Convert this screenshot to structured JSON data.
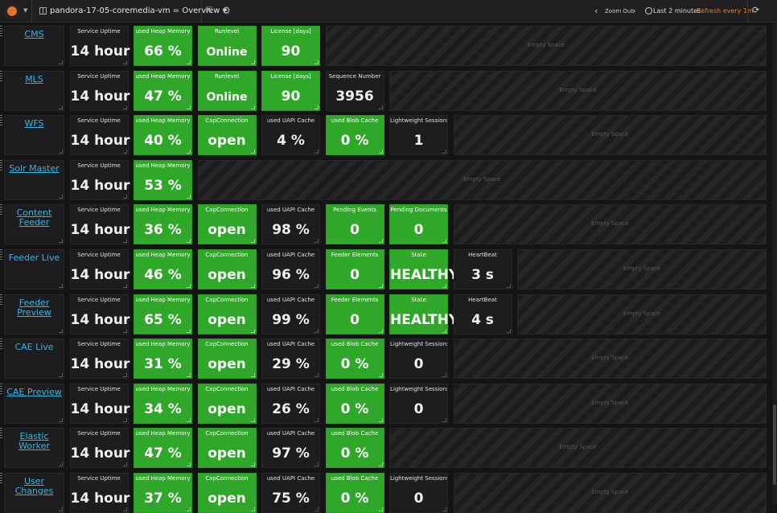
{
  "header": {
    "dashboard_title": "pandora-17-05-coremedia-vm = Overview",
    "zoom_out": "Zoom Out",
    "time_range": "Last 2 minutes",
    "refresh": "Refresh every 1m",
    "empty_space_label": "Empty Space"
  },
  "colors": {
    "green": "#2fa82a",
    "link": "#33b5e5",
    "refresh": "#eb7b18",
    "background": "#141414"
  },
  "rows": [
    {
      "name": "CMS",
      "link": true,
      "panels": [
        {
          "title": "Service Uptime",
          "value": "14 hour",
          "green": false
        },
        {
          "title": "used Heap Memory",
          "value": "66 %",
          "green": true
        },
        {
          "title": "Runlevel",
          "value": "Online",
          "green": true,
          "small": true
        },
        {
          "title": "License [days]",
          "value": "90",
          "green": true
        }
      ]
    },
    {
      "name": "MLS",
      "link": true,
      "panels": [
        {
          "title": "Service Uptime",
          "value": "14 hour",
          "green": false
        },
        {
          "title": "used Heap Memory",
          "value": "47 %",
          "green": true
        },
        {
          "title": "Runlevel",
          "value": "Online",
          "green": true,
          "small": true
        },
        {
          "title": "License [days]",
          "value": "90",
          "green": true
        },
        {
          "title": "Sequence Number",
          "value": "3956",
          "green": false
        }
      ]
    },
    {
      "name": "WFS",
      "link": true,
      "panels": [
        {
          "title": "Service Uptime",
          "value": "14 hour",
          "green": false
        },
        {
          "title": "used Heap Memory",
          "value": "40 %",
          "green": true
        },
        {
          "title": "CapConnection",
          "value": "open",
          "green": true
        },
        {
          "title": "used UAPI Cache",
          "value": "4 %",
          "green": false
        },
        {
          "title": "used Blob Cache",
          "value": "0 %",
          "green": true
        },
        {
          "title": "Lightweight Sessions",
          "value": "1",
          "green": false
        }
      ]
    },
    {
      "name": "Solr Master",
      "link": true,
      "panels": [
        {
          "title": "Service Uptime",
          "value": "14 hour",
          "green": false
        },
        {
          "title": "used Heap Memory",
          "value": "53 %",
          "green": true
        }
      ]
    },
    {
      "name": "Content Feeder",
      "link": true,
      "panels": [
        {
          "title": "Service Uptime",
          "value": "14 hour",
          "green": false
        },
        {
          "title": "used Heap Memory",
          "value": "36 %",
          "green": true
        },
        {
          "title": "CapConnection",
          "value": "open",
          "green": true
        },
        {
          "title": "used UAPI Cache",
          "value": "98 %",
          "green": false
        },
        {
          "title": "Pending Events",
          "value": "0",
          "green": true
        },
        {
          "title": "Pending Documents",
          "value": "0",
          "green": true
        }
      ]
    },
    {
      "name": "Feeder Live",
      "link": false,
      "panels": [
        {
          "title": "Service Uptime",
          "value": "14 hour",
          "green": false
        },
        {
          "title": "used Heap Memory",
          "value": "46 %",
          "green": true
        },
        {
          "title": "CapConnection",
          "value": "open",
          "green": true
        },
        {
          "title": "used UAPI Cache",
          "value": "96 %",
          "green": false
        },
        {
          "title": "Feeder Elements",
          "value": "0",
          "green": true
        },
        {
          "title": "State",
          "value": "HEALTHY",
          "green": true
        },
        {
          "title": "HeartBeat",
          "value": "3 s",
          "green": false
        }
      ]
    },
    {
      "name": "Feeder Preview",
      "link": true,
      "panels": [
        {
          "title": "Service Uptime",
          "value": "14 hour",
          "green": false
        },
        {
          "title": "used Heap Memory",
          "value": "65 %",
          "green": true
        },
        {
          "title": "CapConnection",
          "value": "open",
          "green": true
        },
        {
          "title": "used UAPI Cache",
          "value": "99 %",
          "green": false
        },
        {
          "title": "Feeder Elements",
          "value": "0",
          "green": true
        },
        {
          "title": "State",
          "value": "HEALTHY",
          "green": true
        },
        {
          "title": "HeartBeat",
          "value": "4 s",
          "green": false
        }
      ]
    },
    {
      "name": "CAE Live",
      "link": false,
      "panels": [
        {
          "title": "Service Uptime",
          "value": "14 hour",
          "green": false
        },
        {
          "title": "used Heap Memory",
          "value": "31 %",
          "green": true
        },
        {
          "title": "CapConnection",
          "value": "open",
          "green": true
        },
        {
          "title": "used UAPI Cache",
          "value": "29 %",
          "green": false
        },
        {
          "title": "used Blob Cache",
          "value": "0 %",
          "green": true
        },
        {
          "title": "Lightweight Sessions",
          "value": "0",
          "green": false
        }
      ]
    },
    {
      "name": "CAE Preview",
      "link": true,
      "panels": [
        {
          "title": "Service Uptime",
          "value": "14 hour",
          "green": false
        },
        {
          "title": "used Heap Memory",
          "value": "34 %",
          "green": true
        },
        {
          "title": "CapConnection",
          "value": "open",
          "green": true
        },
        {
          "title": "used UAPI Cache",
          "value": "26 %",
          "green": false
        },
        {
          "title": "used Blob Cache",
          "value": "0 %",
          "green": true
        },
        {
          "title": "Lightweight Sessions",
          "value": "0",
          "green": false
        }
      ]
    },
    {
      "name": "Elastic Worker",
      "link": true,
      "panels": [
        {
          "title": "Service Uptime",
          "value": "14 hour",
          "green": false
        },
        {
          "title": "used Heap Memory",
          "value": "47 %",
          "green": true
        },
        {
          "title": "CapConnection",
          "value": "open",
          "green": true
        },
        {
          "title": "used UAPI Cache",
          "value": "97 %",
          "green": false
        },
        {
          "title": "used Blob Cache",
          "value": "0 %",
          "green": true
        }
      ]
    },
    {
      "name": "User Changes",
      "link": true,
      "panels": [
        {
          "title": "Service Uptime",
          "value": "14 hour",
          "green": false
        },
        {
          "title": "used Heap Memory",
          "value": "37 %",
          "green": true
        },
        {
          "title": "CapConnection",
          "value": "open",
          "green": true
        },
        {
          "title": "used UAPI Cache",
          "value": "75 %",
          "green": false
        },
        {
          "title": "used Blob Cache",
          "value": "0 %",
          "green": true
        },
        {
          "title": "Lightweight Sessions",
          "value": "0",
          "green": false
        }
      ]
    }
  ]
}
